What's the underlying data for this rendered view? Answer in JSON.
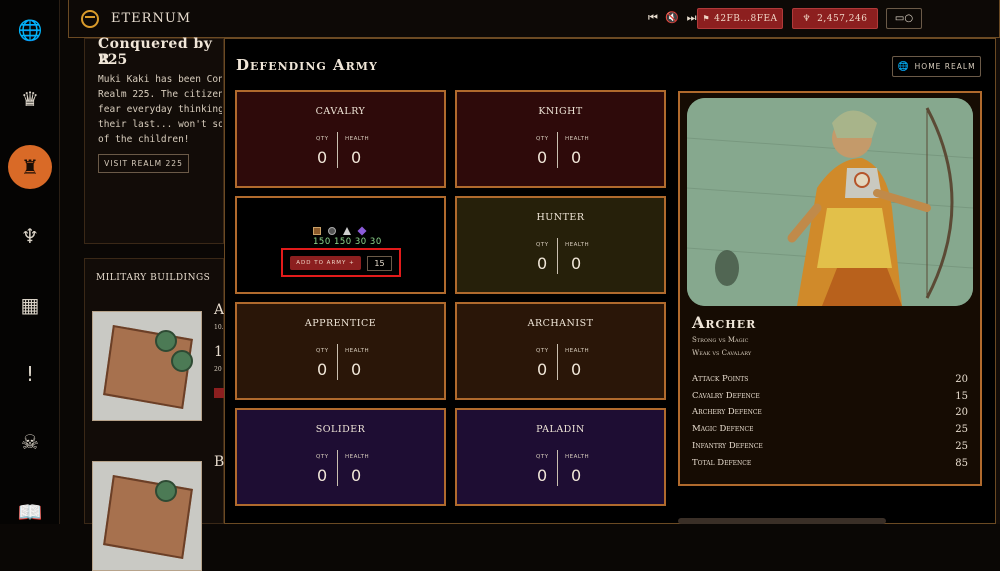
{
  "rail": {
    "items": [
      {
        "icon": "globe-icon",
        "glyph": "🌐"
      },
      {
        "icon": "crown-icon",
        "glyph": "♛"
      },
      {
        "icon": "castle-icon",
        "glyph": "♜"
      },
      {
        "icon": "lords-icon",
        "glyph": "♆"
      },
      {
        "icon": "building-icon",
        "glyph": "▦"
      },
      {
        "icon": "sword-icon",
        "glyph": "!"
      },
      {
        "icon": "skull-icon",
        "glyph": "☠"
      },
      {
        "icon": "book-icon",
        "glyph": "📖"
      }
    ]
  },
  "topbar": {
    "brand": "ETERNUM",
    "media_glyphs": "⏮ 🔇 ⏭",
    "address": "42FB...8FEA",
    "balance": "2,457,246",
    "wallet_glyph": "▭○"
  },
  "background": {
    "title": "Conquered by R",
    "subtitle": "225",
    "text": "Muki Kaki has been Conqu\nRealm 225. The citizens\nfear everyday thinking i\ntheir last... won't some\nof the children!",
    "visit_label": "VISIT REALM 225",
    "military_title": "MILITARY BUILDINGS",
    "building_letters": [
      "A",
      "B"
    ],
    "building_mini": [
      "10.",
      "1(",
      "20"
    ]
  },
  "panel": {
    "title": "Defending Army",
    "home_label": "HOME REALM"
  },
  "units": [
    {
      "name": "CAVALRY",
      "qty_label": "QTY",
      "health_label": "HEALTH",
      "qty": "0",
      "health": "0"
    },
    {
      "name": "KNIGHT",
      "qty_label": "QTY",
      "health_label": "HEALTH",
      "qty": "0",
      "health": "0"
    },
    {
      "name": "HUNTER",
      "qty_label": "QTY",
      "health_label": "HEALTH",
      "qty": "0",
      "health": "0"
    },
    {
      "name": "APPRENTICE",
      "qty_label": "QTY",
      "health_label": "HEALTH",
      "qty": "0",
      "health": "0"
    },
    {
      "name": "ARCHANIST",
      "qty_label": "QTY",
      "health_label": "HEALTH",
      "qty": "0",
      "health": "0"
    },
    {
      "name": "SOLIDER",
      "qty_label": "QTY",
      "health_label": "HEALTH",
      "qty": "0",
      "health": "0"
    },
    {
      "name": "PALADIN",
      "qty_label": "QTY",
      "health_label": "HEALTH",
      "qty": "0",
      "health": "0"
    }
  ],
  "recruit": {
    "costs": [
      "150",
      "150",
      "30",
      "30"
    ],
    "cost_icons": [
      "wood-icon",
      "stone-icon",
      "silver-icon",
      "gem-icon"
    ],
    "add_label": "ADD TO ARMY +",
    "quantity": "15"
  },
  "detail": {
    "name": "Archer",
    "strong": "Strong vs Magic",
    "weak": "Weak vs Cavalary",
    "stats": [
      {
        "label": "Attack Points",
        "value": "20"
      },
      {
        "label": "Cavalry Defence",
        "value": "15"
      },
      {
        "label": "Archery Defence",
        "value": "20"
      },
      {
        "label": "Magic Defence",
        "value": "25"
      },
      {
        "label": "Infantry Defence",
        "value": "25"
      },
      {
        "label": "Total Defence",
        "value": "85"
      }
    ]
  },
  "colors": {
    "accent_orange": "#d96a27",
    "border_gold": "#b06a2d",
    "button_red": "#8c1f1f",
    "highlight_red": "#e21b1b",
    "cost_green": "#8fd88f"
  }
}
